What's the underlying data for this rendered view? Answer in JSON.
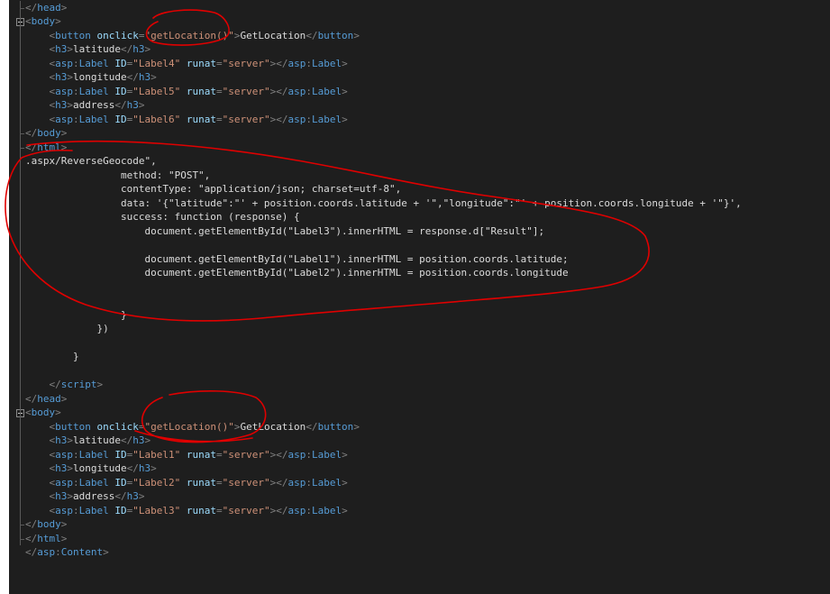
{
  "lines": [
    {
      "indent": 0,
      "segments": [
        {
          "t": "punct",
          "v": "</"
        },
        {
          "t": "tag",
          "v": "head"
        },
        {
          "t": "punct",
          "v": ">"
        }
      ]
    },
    {
      "indent": 0,
      "fold": true,
      "segments": [
        {
          "t": "punct",
          "v": "<"
        },
        {
          "t": "tag",
          "v": "body"
        },
        {
          "t": "punct",
          "v": ">"
        }
      ]
    },
    {
      "indent": 4,
      "segments": [
        {
          "t": "punct",
          "v": "<"
        },
        {
          "t": "tag",
          "v": "button"
        },
        {
          "t": "text",
          "v": " "
        },
        {
          "t": "attr",
          "v": "onclick"
        },
        {
          "t": "punct",
          "v": "="
        },
        {
          "t": "val",
          "v": "\"getLocation()\""
        },
        {
          "t": "punct",
          "v": ">"
        },
        {
          "t": "text",
          "v": "GetLocation"
        },
        {
          "t": "punct",
          "v": "</"
        },
        {
          "t": "tag",
          "v": "button"
        },
        {
          "t": "punct",
          "v": ">"
        }
      ]
    },
    {
      "indent": 4,
      "segments": [
        {
          "t": "punct",
          "v": "<"
        },
        {
          "t": "tag",
          "v": "h3"
        },
        {
          "t": "punct",
          "v": ">"
        },
        {
          "t": "text",
          "v": "latitude"
        },
        {
          "t": "punct",
          "v": "</"
        },
        {
          "t": "tag",
          "v": "h3"
        },
        {
          "t": "punct",
          "v": ">"
        }
      ]
    },
    {
      "indent": 4,
      "segments": [
        {
          "t": "punct",
          "v": "<"
        },
        {
          "t": "tag",
          "v": "asp"
        },
        {
          "t": "punct",
          "v": ":"
        },
        {
          "t": "tag",
          "v": "Label"
        },
        {
          "t": "text",
          "v": " "
        },
        {
          "t": "attr",
          "v": "ID"
        },
        {
          "t": "punct",
          "v": "="
        },
        {
          "t": "val",
          "v": "\"Label4\""
        },
        {
          "t": "text",
          "v": " "
        },
        {
          "t": "attr",
          "v": "runat"
        },
        {
          "t": "punct",
          "v": "="
        },
        {
          "t": "val",
          "v": "\"server\""
        },
        {
          "t": "punct",
          "v": "></"
        },
        {
          "t": "tag",
          "v": "asp"
        },
        {
          "t": "punct",
          "v": ":"
        },
        {
          "t": "tag",
          "v": "Label"
        },
        {
          "t": "punct",
          "v": ">"
        }
      ]
    },
    {
      "indent": 4,
      "segments": [
        {
          "t": "punct",
          "v": "<"
        },
        {
          "t": "tag",
          "v": "h3"
        },
        {
          "t": "punct",
          "v": ">"
        },
        {
          "t": "text",
          "v": "longitude"
        },
        {
          "t": "punct",
          "v": "</"
        },
        {
          "t": "tag",
          "v": "h3"
        },
        {
          "t": "punct",
          "v": ">"
        }
      ]
    },
    {
      "indent": 4,
      "segments": [
        {
          "t": "punct",
          "v": "<"
        },
        {
          "t": "tag",
          "v": "asp"
        },
        {
          "t": "punct",
          "v": ":"
        },
        {
          "t": "tag",
          "v": "Label"
        },
        {
          "t": "text",
          "v": " "
        },
        {
          "t": "attr",
          "v": "ID"
        },
        {
          "t": "punct",
          "v": "="
        },
        {
          "t": "val",
          "v": "\"Label5\""
        },
        {
          "t": "text",
          "v": " "
        },
        {
          "t": "attr",
          "v": "runat"
        },
        {
          "t": "punct",
          "v": "="
        },
        {
          "t": "val",
          "v": "\"server\""
        },
        {
          "t": "punct",
          "v": "></"
        },
        {
          "t": "tag",
          "v": "asp"
        },
        {
          "t": "punct",
          "v": ":"
        },
        {
          "t": "tag",
          "v": "Label"
        },
        {
          "t": "punct",
          "v": ">"
        }
      ]
    },
    {
      "indent": 4,
      "segments": [
        {
          "t": "punct",
          "v": "<"
        },
        {
          "t": "tag",
          "v": "h3"
        },
        {
          "t": "punct",
          "v": ">"
        },
        {
          "t": "text",
          "v": "address"
        },
        {
          "t": "punct",
          "v": "</"
        },
        {
          "t": "tag",
          "v": "h3"
        },
        {
          "t": "punct",
          "v": ">"
        }
      ]
    },
    {
      "indent": 4,
      "segments": [
        {
          "t": "punct",
          "v": "<"
        },
        {
          "t": "tag",
          "v": "asp"
        },
        {
          "t": "punct",
          "v": ":"
        },
        {
          "t": "tag",
          "v": "Label"
        },
        {
          "t": "text",
          "v": " "
        },
        {
          "t": "attr",
          "v": "ID"
        },
        {
          "t": "punct",
          "v": "="
        },
        {
          "t": "val",
          "v": "\"Label6\""
        },
        {
          "t": "text",
          "v": " "
        },
        {
          "t": "attr",
          "v": "runat"
        },
        {
          "t": "punct",
          "v": "="
        },
        {
          "t": "val",
          "v": "\"server\""
        },
        {
          "t": "punct",
          "v": "></"
        },
        {
          "t": "tag",
          "v": "asp"
        },
        {
          "t": "punct",
          "v": ":"
        },
        {
          "t": "tag",
          "v": "Label"
        },
        {
          "t": "punct",
          "v": ">"
        }
      ]
    },
    {
      "indent": 0,
      "segments": [
        {
          "t": "punct",
          "v": "</"
        },
        {
          "t": "tag",
          "v": "body"
        },
        {
          "t": "punct",
          "v": ">"
        }
      ]
    },
    {
      "indent": 0,
      "segments": [
        {
          "t": "punct",
          "v": "</"
        },
        {
          "t": "tag",
          "v": "html"
        },
        {
          "t": "punct",
          "v": ">"
        }
      ]
    },
    {
      "indent": 0,
      "segments": [
        {
          "t": "text",
          "v": ".aspx/ReverseGeocode\","
        }
      ]
    },
    {
      "indent": 16,
      "segments": [
        {
          "t": "text",
          "v": "method: \"POST\","
        }
      ]
    },
    {
      "indent": 16,
      "segments": [
        {
          "t": "text",
          "v": "contentType: \"application/json; charset=utf-8\","
        }
      ]
    },
    {
      "indent": 16,
      "segments": [
        {
          "t": "text",
          "v": "data: '{\"latitude\":\"' + position.coords.latitude + '\",\"longitude\":\"' + position.coords.longitude + '\"}',"
        }
      ]
    },
    {
      "indent": 16,
      "segments": [
        {
          "t": "text",
          "v": "success: function (response) {"
        }
      ]
    },
    {
      "indent": 20,
      "segments": [
        {
          "t": "text",
          "v": "document.getElementById(\"Label3\").innerHTML = response.d[\"Result\"];"
        }
      ]
    },
    {
      "indent": 0,
      "segments": []
    },
    {
      "indent": 20,
      "segments": [
        {
          "t": "text",
          "v": "document.getElementById(\"Label1\").innerHTML = position.coords.latitude;"
        }
      ]
    },
    {
      "indent": 20,
      "segments": [
        {
          "t": "text",
          "v": "document.getElementById(\"Label2\").innerHTML = position.coords.longitude"
        }
      ]
    },
    {
      "indent": 0,
      "segments": []
    },
    {
      "indent": 0,
      "segments": []
    },
    {
      "indent": 16,
      "segments": [
        {
          "t": "text",
          "v": "}"
        }
      ]
    },
    {
      "indent": 12,
      "segments": [
        {
          "t": "text",
          "v": "})"
        }
      ]
    },
    {
      "indent": 0,
      "segments": []
    },
    {
      "indent": 8,
      "segments": [
        {
          "t": "text",
          "v": "}"
        }
      ]
    },
    {
      "indent": 0,
      "segments": []
    },
    {
      "indent": 4,
      "segments": [
        {
          "t": "punct",
          "v": "</"
        },
        {
          "t": "tag",
          "v": "script"
        },
        {
          "t": "punct",
          "v": ">"
        }
      ]
    },
    {
      "indent": 0,
      "segments": [
        {
          "t": "punct",
          "v": "</"
        },
        {
          "t": "tag",
          "v": "head"
        },
        {
          "t": "punct",
          "v": ">"
        }
      ]
    },
    {
      "indent": 0,
      "fold": true,
      "segments": [
        {
          "t": "punct",
          "v": "<"
        },
        {
          "t": "tag",
          "v": "body"
        },
        {
          "t": "punct",
          "v": ">"
        }
      ]
    },
    {
      "indent": 4,
      "segments": [
        {
          "t": "punct",
          "v": "<"
        },
        {
          "t": "tag",
          "v": "button"
        },
        {
          "t": "text",
          "v": " "
        },
        {
          "t": "attr",
          "v": "onclick"
        },
        {
          "t": "punct",
          "v": "="
        },
        {
          "t": "val",
          "v": "\"getLocation()\""
        },
        {
          "t": "punct",
          "v": ">"
        },
        {
          "t": "text",
          "v": "GetLocation"
        },
        {
          "t": "punct",
          "v": "</"
        },
        {
          "t": "tag",
          "v": "button"
        },
        {
          "t": "punct",
          "v": ">"
        }
      ]
    },
    {
      "indent": 4,
      "segments": [
        {
          "t": "punct",
          "v": "<"
        },
        {
          "t": "tag",
          "v": "h3"
        },
        {
          "t": "punct",
          "v": ">"
        },
        {
          "t": "text",
          "v": "latitude"
        },
        {
          "t": "punct",
          "v": "</"
        },
        {
          "t": "tag",
          "v": "h3"
        },
        {
          "t": "punct",
          "v": ">"
        }
      ]
    },
    {
      "indent": 4,
      "segments": [
        {
          "t": "punct",
          "v": "<"
        },
        {
          "t": "tag",
          "v": "asp"
        },
        {
          "t": "punct",
          "v": ":"
        },
        {
          "t": "tag",
          "v": "Label"
        },
        {
          "t": "text",
          "v": " "
        },
        {
          "t": "attr",
          "v": "ID"
        },
        {
          "t": "punct",
          "v": "="
        },
        {
          "t": "val",
          "v": "\"Label1\""
        },
        {
          "t": "text",
          "v": " "
        },
        {
          "t": "attr",
          "v": "runat"
        },
        {
          "t": "punct",
          "v": "="
        },
        {
          "t": "val",
          "v": "\"server\""
        },
        {
          "t": "punct",
          "v": "></"
        },
        {
          "t": "tag",
          "v": "asp"
        },
        {
          "t": "punct",
          "v": ":"
        },
        {
          "t": "tag",
          "v": "Label"
        },
        {
          "t": "punct",
          "v": ">"
        }
      ]
    },
    {
      "indent": 4,
      "segments": [
        {
          "t": "punct",
          "v": "<"
        },
        {
          "t": "tag",
          "v": "h3"
        },
        {
          "t": "punct",
          "v": ">"
        },
        {
          "t": "text",
          "v": "longitude"
        },
        {
          "t": "punct",
          "v": "</"
        },
        {
          "t": "tag",
          "v": "h3"
        },
        {
          "t": "punct",
          "v": ">"
        }
      ]
    },
    {
      "indent": 4,
      "segments": [
        {
          "t": "punct",
          "v": "<"
        },
        {
          "t": "tag",
          "v": "asp"
        },
        {
          "t": "punct",
          "v": ":"
        },
        {
          "t": "tag",
          "v": "Label"
        },
        {
          "t": "text",
          "v": " "
        },
        {
          "t": "attr",
          "v": "ID"
        },
        {
          "t": "punct",
          "v": "="
        },
        {
          "t": "val",
          "v": "\"Label2\""
        },
        {
          "t": "text",
          "v": " "
        },
        {
          "t": "attr",
          "v": "runat"
        },
        {
          "t": "punct",
          "v": "="
        },
        {
          "t": "val",
          "v": "\"server\""
        },
        {
          "t": "punct",
          "v": "></"
        },
        {
          "t": "tag",
          "v": "asp"
        },
        {
          "t": "punct",
          "v": ":"
        },
        {
          "t": "tag",
          "v": "Label"
        },
        {
          "t": "punct",
          "v": ">"
        }
      ]
    },
    {
      "indent": 4,
      "segments": [
        {
          "t": "punct",
          "v": "<"
        },
        {
          "t": "tag",
          "v": "h3"
        },
        {
          "t": "punct",
          "v": ">"
        },
        {
          "t": "text",
          "v": "address"
        },
        {
          "t": "punct",
          "v": "</"
        },
        {
          "t": "tag",
          "v": "h3"
        },
        {
          "t": "punct",
          "v": ">"
        }
      ]
    },
    {
      "indent": 4,
      "segments": [
        {
          "t": "punct",
          "v": "<"
        },
        {
          "t": "tag",
          "v": "asp"
        },
        {
          "t": "punct",
          "v": ":"
        },
        {
          "t": "tag",
          "v": "Label"
        },
        {
          "t": "text",
          "v": " "
        },
        {
          "t": "attr",
          "v": "ID"
        },
        {
          "t": "punct",
          "v": "="
        },
        {
          "t": "val",
          "v": "\"Label3\""
        },
        {
          "t": "text",
          "v": " "
        },
        {
          "t": "attr",
          "v": "runat"
        },
        {
          "t": "punct",
          "v": "="
        },
        {
          "t": "val",
          "v": "\"server\""
        },
        {
          "t": "punct",
          "v": "></"
        },
        {
          "t": "tag",
          "v": "asp"
        },
        {
          "t": "punct",
          "v": ":"
        },
        {
          "t": "tag",
          "v": "Label"
        },
        {
          "t": "punct",
          "v": ">"
        }
      ]
    },
    {
      "indent": 0,
      "segments": [
        {
          "t": "punct",
          "v": "</"
        },
        {
          "t": "tag",
          "v": "body"
        },
        {
          "t": "punct",
          "v": ">"
        }
      ]
    },
    {
      "indent": 0,
      "segments": [
        {
          "t": "punct",
          "v": "</"
        },
        {
          "t": "tag",
          "v": "html"
        },
        {
          "t": "punct",
          "v": ">"
        }
      ]
    },
    {
      "indent": 0,
      "segments": [
        {
          "t": "punct",
          "v": "</"
        },
        {
          "t": "tag",
          "v": "asp"
        },
        {
          "t": "punct",
          "v": ":"
        },
        {
          "t": "tag",
          "v": "Content"
        },
        {
          "t": "punct",
          "v": ">"
        }
      ]
    }
  ],
  "colors": {
    "editor_background": "#1e1e1e",
    "tag": "#569cd6",
    "attribute": "#9cdcfe",
    "attribute_value": "#ce9178",
    "punctuation": "#808080",
    "text": "#dcdcdc",
    "annotation": "#e00000"
  },
  "annotations": {
    "marks": [
      "top-getlocation-circle",
      "script-block-loop",
      "bottom-getlocation-circle"
    ]
  }
}
